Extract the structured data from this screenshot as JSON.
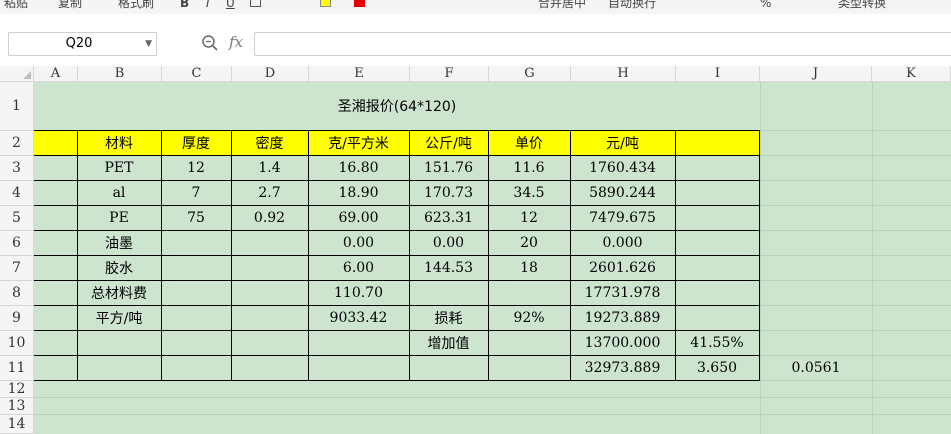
{
  "toolbar": {
    "items": [
      "粘贴",
      "复制",
      "格式刷",
      "B",
      "I",
      "U",
      "合并居中",
      "自动换行",
      "%",
      "类型转换"
    ]
  },
  "formula_bar": {
    "name_box": "Q20",
    "fx_label": "fx",
    "formula": ""
  },
  "columns": [
    "A",
    "B",
    "C",
    "D",
    "E",
    "F",
    "G",
    "H",
    "I",
    "J",
    "K"
  ],
  "rows": [
    "1",
    "2",
    "3",
    "4",
    "5",
    "6",
    "7",
    "8",
    "9",
    "10",
    "11",
    "12",
    "13",
    "14"
  ],
  "sheet": {
    "title": "圣湘报价(64*120)",
    "headers": [
      "材料",
      "厚度",
      "密度",
      "克/平方米",
      "公斤/吨",
      "单价",
      "元/吨"
    ],
    "r3": [
      "PET",
      "12",
      "1.4",
      "16.80",
      "151.76",
      "11.6",
      "1760.434"
    ],
    "r4": [
      "al",
      "7",
      "2.7",
      "18.90",
      "170.73",
      "34.5",
      "5890.244"
    ],
    "r5": [
      "PE",
      "75",
      "0.92",
      "69.00",
      "623.31",
      "12",
      "7479.675"
    ],
    "r6": [
      "油墨",
      "0.00",
      "0.00",
      "20",
      "0.000"
    ],
    "r7": [
      "胶水",
      "6.00",
      "144.53",
      "18",
      "2601.626"
    ],
    "r8": [
      "总材料费",
      "110.70",
      "17731.978"
    ],
    "r9": [
      "平方/吨",
      "9033.42",
      "损耗",
      "92%",
      "19273.889"
    ],
    "r10": [
      "增加值",
      "13700.000",
      "41.55%"
    ],
    "r11": [
      "32973.889",
      "3.650",
      "0.0561"
    ]
  },
  "colors": {
    "grid_background": "#cde5cf",
    "header_fill": "#ffff00",
    "border": "#000000"
  }
}
